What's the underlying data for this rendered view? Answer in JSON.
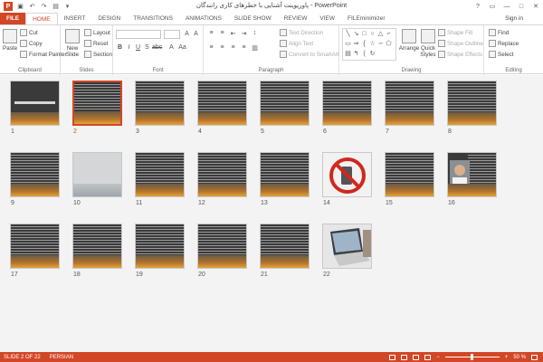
{
  "window": {
    "title": "پاورپوینت آشنایی با خطرهای کاری رانندگان - PowerPoint",
    "controls": [
      "?",
      "▭",
      "—",
      "□",
      "✕"
    ]
  },
  "tabs": [
    {
      "label": "FILE"
    },
    {
      "label": "HOME"
    },
    {
      "label": "INSERT"
    },
    {
      "label": "DESIGN"
    },
    {
      "label": "TRANSITIONS"
    },
    {
      "label": "ANIMATIONS"
    },
    {
      "label": "SLIDE SHOW"
    },
    {
      "label": "REVIEW"
    },
    {
      "label": "VIEW"
    },
    {
      "label": "FILEminimizer"
    }
  ],
  "signin": "Sign in",
  "ribbon": {
    "clipboard": {
      "paste": "Paste",
      "cut": "Cut",
      "copy": "Copy",
      "format_painter": "Format Painter",
      "label": "Clipboard"
    },
    "slides": {
      "new_slide": "New Slide",
      "layout": "Layout",
      "reset": "Reset",
      "section": "Section",
      "label": "Slides"
    },
    "font": {
      "label": "Font"
    },
    "paragraph": {
      "text_direction": "Text Direction",
      "align_text": "Align Text",
      "convert_smartart": "Convert to SmartArt",
      "label": "Paragraph"
    },
    "drawing": {
      "arrange": "Arrange",
      "quick_styles": "Quick Styles",
      "shape_fill": "Shape Fill",
      "shape_outline": "Shape Outline",
      "shape_effects": "Shape Effects",
      "label": "Drawing"
    },
    "editing": {
      "find": "Find",
      "replace": "Replace",
      "select": "Select",
      "label": "Editing"
    }
  },
  "slides": [
    {
      "num": "1"
    },
    {
      "num": "2"
    },
    {
      "num": "3"
    },
    {
      "num": "4"
    },
    {
      "num": "5"
    },
    {
      "num": "6"
    },
    {
      "num": "7"
    },
    {
      "num": "8"
    },
    {
      "num": "9"
    },
    {
      "num": "10"
    },
    {
      "num": "11"
    },
    {
      "num": "12"
    },
    {
      "num": "13"
    },
    {
      "num": "14"
    },
    {
      "num": "15"
    },
    {
      "num": "16"
    },
    {
      "num": "17"
    },
    {
      "num": "18"
    },
    {
      "num": "19"
    },
    {
      "num": "20"
    },
    {
      "num": "21"
    },
    {
      "num": "22"
    }
  ],
  "title_slide_text": "آشنایی با خطرهای کاری رانندگان",
  "status": {
    "slide_info": "SLIDE 2 OF 22",
    "language": "PERSIAN",
    "zoom": "50 %"
  },
  "colors": {
    "accent": "#d24726"
  }
}
